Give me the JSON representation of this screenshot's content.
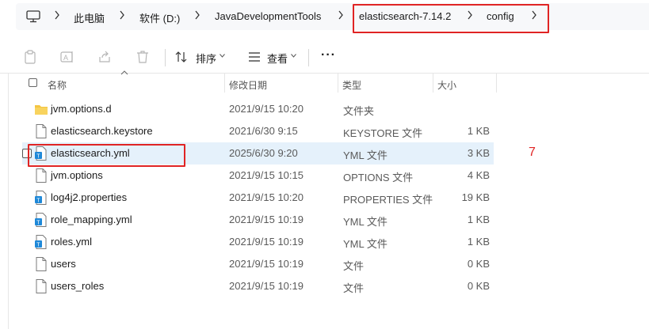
{
  "breadcrumb": {
    "items": [
      "此电脑",
      "软件 (D:)",
      "JavaDevelopmentTools",
      "elasticsearch-7.14.2",
      "config"
    ]
  },
  "toolbar": {
    "sort_label": "排序",
    "view_label": "查看",
    "more_label": "···"
  },
  "columns": {
    "name": "名称",
    "modified": "修改日期",
    "type": "类型",
    "size": "大小"
  },
  "files": [
    {
      "name": "jvm.options.d",
      "modified": "2021/9/15 10:20",
      "type": "文件夹",
      "size": "",
      "icon": "folder-icon"
    },
    {
      "name": "elasticsearch.keystore",
      "modified": "2021/6/30 9:15",
      "type": "KEYSTORE 文件",
      "size": "1 KB",
      "icon": "file-icon"
    },
    {
      "name": "elasticsearch.yml",
      "modified": "2025/6/30 9:20",
      "type": "YML 文件",
      "size": "3 KB",
      "icon": "text-file-icon"
    },
    {
      "name": "jvm.options",
      "modified": "2021/9/15 10:15",
      "type": "OPTIONS 文件",
      "size": "4 KB",
      "icon": "file-icon"
    },
    {
      "name": "log4j2.properties",
      "modified": "2021/9/15 10:20",
      "type": "PROPERTIES 文件",
      "size": "19 KB",
      "icon": "text-file-icon"
    },
    {
      "name": "role_mapping.yml",
      "modified": "2021/9/15 10:19",
      "type": "YML 文件",
      "size": "1 KB",
      "icon": "text-file-icon"
    },
    {
      "name": "roles.yml",
      "modified": "2021/9/15 10:19",
      "type": "YML 文件",
      "size": "1 KB",
      "icon": "text-file-icon"
    },
    {
      "name": "users",
      "modified": "2021/9/15 10:19",
      "type": "文件",
      "size": "0 KB",
      "icon": "file-icon"
    },
    {
      "name": "users_roles",
      "modified": "2021/9/15 10:19",
      "type": "文件",
      "size": "0 KB",
      "icon": "file-icon"
    }
  ],
  "annotation": "7",
  "colors": {
    "highlight": "#e02424",
    "selected_row": "#e5f1fb",
    "folder": "#f4c542",
    "file_badge": "#1e88d8"
  }
}
